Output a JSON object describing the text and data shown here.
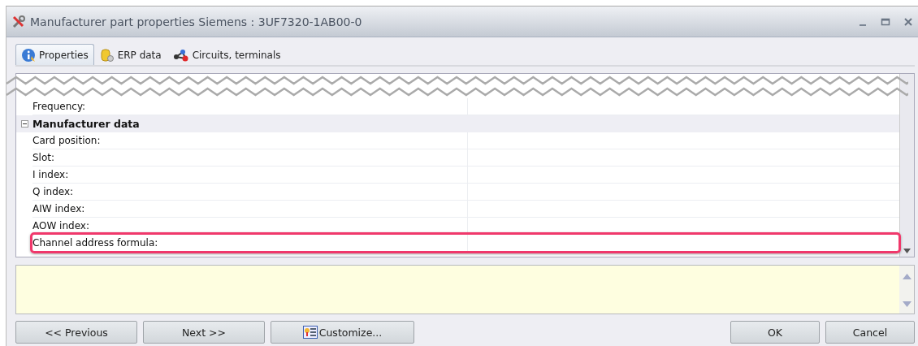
{
  "window": {
    "title": "Manufacturer part properties Siemens : 3UF7320-1AB00-0"
  },
  "tabs": [
    {
      "label": "Properties",
      "selected": true
    },
    {
      "label": "ERP data",
      "selected": false
    },
    {
      "label": "Circuits, terminals",
      "selected": false
    }
  ],
  "grid": {
    "rows": [
      {
        "kind": "property",
        "label": "Frequency:",
        "highlighted": false
      },
      {
        "kind": "category",
        "label": "Manufacturer data",
        "expanded": true
      },
      {
        "kind": "property",
        "label": "Card position:",
        "highlighted": false
      },
      {
        "kind": "property",
        "label": "Slot:",
        "highlighted": false
      },
      {
        "kind": "property",
        "label": "I index:",
        "highlighted": false
      },
      {
        "kind": "property",
        "label": "Q index:",
        "highlighted": false
      },
      {
        "kind": "property",
        "label": "AIW index:",
        "highlighted": false
      },
      {
        "kind": "property",
        "label": "AOW index:",
        "highlighted": false
      },
      {
        "kind": "property",
        "label": "Channel address formula:",
        "highlighted": true
      }
    ]
  },
  "buttons_left": [
    {
      "label": "<< Previous"
    },
    {
      "label": "Next >>"
    },
    {
      "label": "Customize..."
    }
  ],
  "buttons_right": [
    {
      "label": "OK"
    },
    {
      "label": "Cancel"
    }
  ]
}
